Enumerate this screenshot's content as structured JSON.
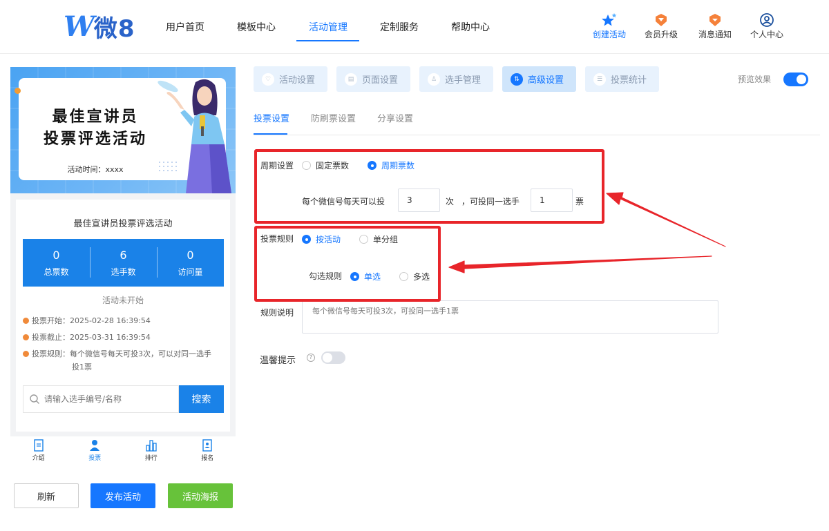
{
  "header": {
    "logo_text": "微8",
    "nav": [
      "用户首页",
      "模板中心",
      "活动管理",
      "定制服务",
      "帮助中心"
    ],
    "active_nav": "活动管理",
    "actions": [
      "创建活动",
      "会员升级",
      "消息通知",
      "个人中心"
    ]
  },
  "preview": {
    "banner_title_1": "最佳宣讲员",
    "banner_title_2": "投票评选活动",
    "banner_time": "活动时间：xxxx",
    "activity_title": "最佳宣讲员投票评选活动",
    "stats": [
      {
        "value": "0",
        "label": "总票数"
      },
      {
        "value": "6",
        "label": "选手数"
      },
      {
        "value": "0",
        "label": "访问量"
      }
    ],
    "status": "活动未开始",
    "vote_start": "投票开始：2025-02-28 16:39:54",
    "vote_end": "投票截止：2025-03-31 16:39:54",
    "vote_rule": "投票规则：每个微信号每天可投3次，可以对同一选手",
    "vote_rule_cont": "投1票",
    "search_placeholder": "请输入选手编号/名称",
    "search_button": "搜索",
    "tabbar": [
      "介绍",
      "投票",
      "排行",
      "报名"
    ]
  },
  "buttons": {
    "refresh": "刷新",
    "publish": "发布活动",
    "poster": "活动海报"
  },
  "settings": {
    "step_tabs": [
      "活动设置",
      "页面设置",
      "选手管理",
      "高级设置",
      "投票统计"
    ],
    "active_step": "高级设置",
    "preview_label": "预览效果",
    "preview_on": true,
    "sub_tabs": [
      "投票设置",
      "防刷票设置",
      "分享设置"
    ],
    "active_sub_tab": "投票设置",
    "cycle_label": "周期设置",
    "cycle_options": [
      "固定票数",
      "周期票数"
    ],
    "cycle_selected": "周期票数",
    "per_day_prefix": "每个微信号每天可以投",
    "per_day_value": "3",
    "times_unit": "次",
    "same_player_text": "，可投同一选手",
    "same_player_value": "1",
    "vote_unit": "票",
    "rule_label": "投票规则",
    "rule_options": [
      "按活动",
      "单分组"
    ],
    "rule_selected": "按活动",
    "check_label": "勾选规则",
    "check_options": [
      "单选",
      "多选"
    ],
    "check_selected": "单选",
    "desc_label": "规则说明",
    "desc_placeholder": "每个微信号每天可投3次，可投同一选手1票",
    "tip_label": "温馨提示",
    "tip_on": false
  },
  "colors": {
    "primary": "#1677ff",
    "annotation": "#e8252a",
    "green": "#67c23a",
    "stats_bg": "#1a82e8"
  }
}
